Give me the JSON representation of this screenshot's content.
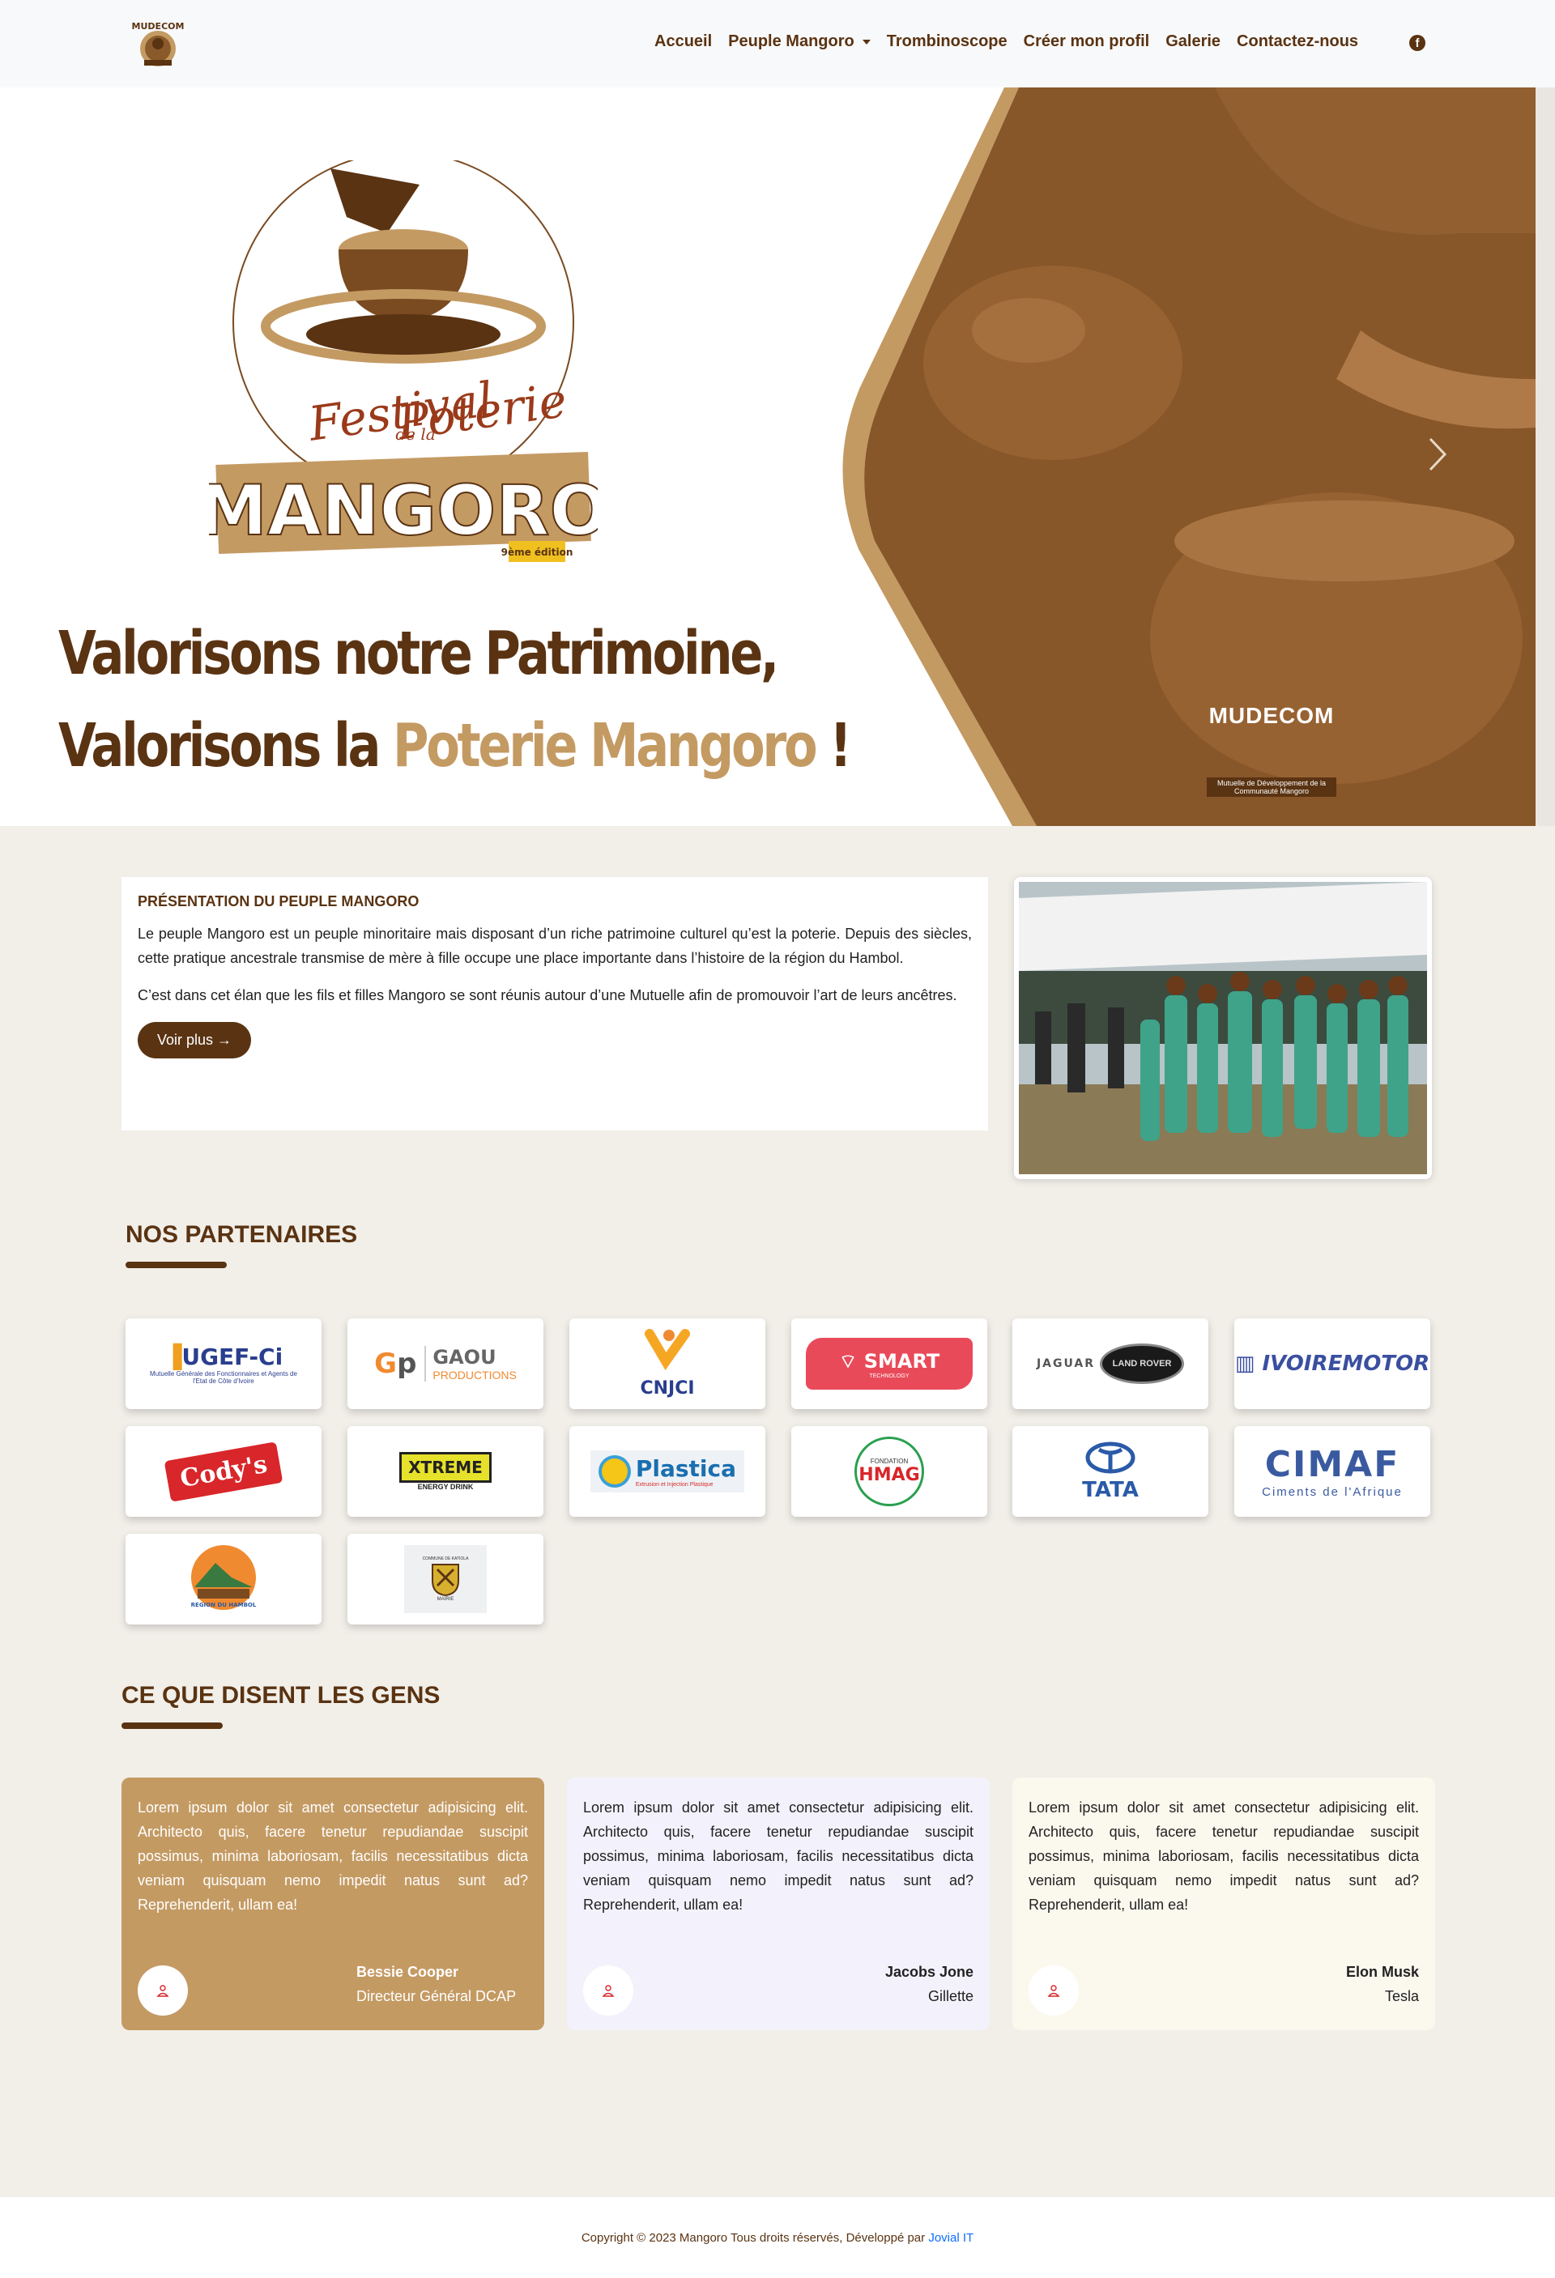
{
  "nav": {
    "logo_text": "MUDECOM",
    "links": [
      "Accueil",
      "Peuple Mangoro",
      "Trombinoscope",
      "Créer mon profil",
      "Galerie",
      "Contactez-nous"
    ],
    "facebook_icon": "facebook-icon"
  },
  "hero": {
    "logo_line1": "Festival",
    "logo_line2": "de la",
    "logo_line3": "Poterie",
    "logo_brand": "MANGORO",
    "logo_edition": "9ème édition",
    "headline_1": "Valorisons notre Patrimoine,",
    "headline_2_prefix": "Valorisons la ",
    "headline_2_accent": "Poterie Mangoro",
    "headline_2_suffix": " !",
    "badge_title": "MUDECOM",
    "badge_sub": "Mutuelle de Développement de la Communauté Mangoro",
    "next_icon": "chevron-right-icon",
    "colors": {
      "brown": "#5a3312",
      "tan": "#c49a63"
    }
  },
  "presentation": {
    "title": "PRÉSENTATION DU PEUPLE MANGORO",
    "paragraph_1": "Le peuple Mangoro est un peuple minoritaire mais disposant d’un riche patrimoine culturel qu’est la poterie. Depuis des siècles, cette pratique ancestrale transmise de mère à fille occupe une place importante dans l’histoire de la région du Hambol.",
    "paragraph_2": "C’est dans cet élan que les fils et filles Mangoro se sont réunis autour d’une Mutuelle afin de promouvoir l’art de leurs ancêtres.",
    "button": "Voir plus →"
  },
  "partners": {
    "title": "NOS PARTENAIRES",
    "logos": {
      "ugef": {
        "main": "UGEF-Ci",
        "sub": "Mutuelle Générale des Fonctionnaires et Agents de l'Etat de Côte d'Ivoire"
      },
      "gaou": {
        "main": "GAOU",
        "sub": "PRODUCTIONS"
      },
      "cnjci": {
        "main": "CNJCI"
      },
      "smart": {
        "main": "SMART",
        "sub": "TECHNOLOGY"
      },
      "jaguar": {
        "main": "JAGUAR",
        "sub": "LAND ROVER"
      },
      "ivoiremotor": {
        "main": "IVOIREMOTOR"
      },
      "codys": {
        "main": "Cody's"
      },
      "xtreme": {
        "main": "XTREME",
        "sub": "ENERGY DRINK"
      },
      "plastica": {
        "main": "Plastica",
        "sub": "Extrusion et Injection Plastique"
      },
      "hmag": {
        "main": "HMAG",
        "sub": "FONDATION"
      },
      "tata": {
        "main": "TATA"
      },
      "cimaf": {
        "main": "CIMAF",
        "sub": "Ciments de l'Afrique"
      },
      "hambol": {
        "main": "REGION DU HAMBOL"
      },
      "katiola": {
        "main": "COMMUNE DE KATIOLA",
        "sub": "MAIRIE"
      }
    }
  },
  "testimonials": {
    "title": "CE QUE DISENT LES GENS",
    "items": [
      {
        "text": "Lorem ipsum dolor sit amet consectetur adipisicing elit. Architecto quis, facere tenetur repudiandae suscipit possimus, minima laboriosam, facilis necessitatibus dicta veniam quisquam nemo impedit natus sunt ad? Reprehenderit, ullam ea!",
        "name": "Bessie Cooper",
        "role": "Directeur Général DCAP",
        "bg": "#c49a63"
      },
      {
        "text": "Lorem ipsum dolor sit amet consectetur adipisicing elit. Architecto quis, facere tenetur repudiandae suscipit possimus, minima laboriosam, facilis necessitatibus dicta veniam quisquam nemo impedit natus sunt ad? Reprehenderit, ullam ea!",
        "name": "Jacobs Jone",
        "role": "Gillette",
        "bg": "#f3f2fc"
      },
      {
        "text": "Lorem ipsum dolor sit amet consectetur adipisicing elit. Architecto quis, facere tenetur repudiandae suscipit possimus, minima laboriosam, facilis necessitatibus dicta veniam quisquam nemo impedit natus sunt ad? Reprehenderit, ullam ea!",
        "name": "Elon Musk",
        "role": "Tesla",
        "bg": "#fbf8ee"
      }
    ]
  },
  "footer": {
    "text": "Copyright © 2023 Mangoro Tous droits réservés, Développé par ",
    "link": "Jovial IT"
  }
}
